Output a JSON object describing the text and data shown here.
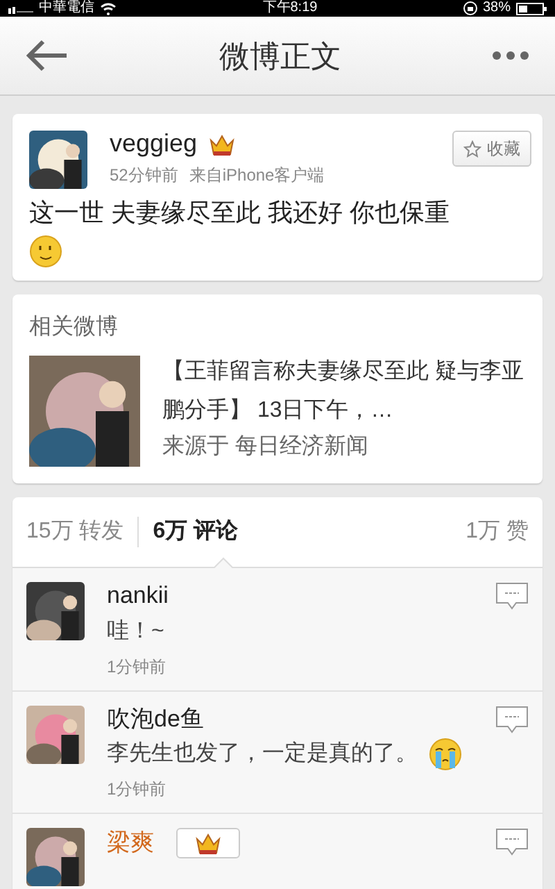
{
  "status_bar": {
    "carrier": "中華電信",
    "time": "下午8:19",
    "battery": "38%"
  },
  "nav": {
    "title": "微博正文"
  },
  "post": {
    "author": "veggieg",
    "vip": true,
    "time": "52分钟前",
    "source": "来自iPhone客户端",
    "collect_label": "收藏",
    "text": "这一世 夫妻缘尽至此 我还好 你也保重",
    "emoji": {
      "kind": "smile"
    }
  },
  "related": {
    "heading": "相关微博",
    "title": "【王菲留言称夫妻缘尽至此 疑与李亚鹏分手】 13日下午，…",
    "source": "来源于 每日经济新闻"
  },
  "stats": [
    {
      "count": "15万",
      "label": "转发",
      "selected": false
    },
    {
      "count": "6万",
      "label": "评论",
      "selected": true
    },
    {
      "count": "1万",
      "label": "赞",
      "selected": false
    }
  ],
  "comments": [
    {
      "name": "nankii",
      "member": false,
      "text": "哇！~",
      "time": "1分钟前"
    },
    {
      "name": "吹泡de鱼",
      "member": false,
      "text": "李先生也发了，一定是真的了。",
      "emoji": {
        "kind": "crying"
      },
      "time": "1分钟前"
    },
    {
      "name": "梁爽",
      "member": true
    }
  ]
}
